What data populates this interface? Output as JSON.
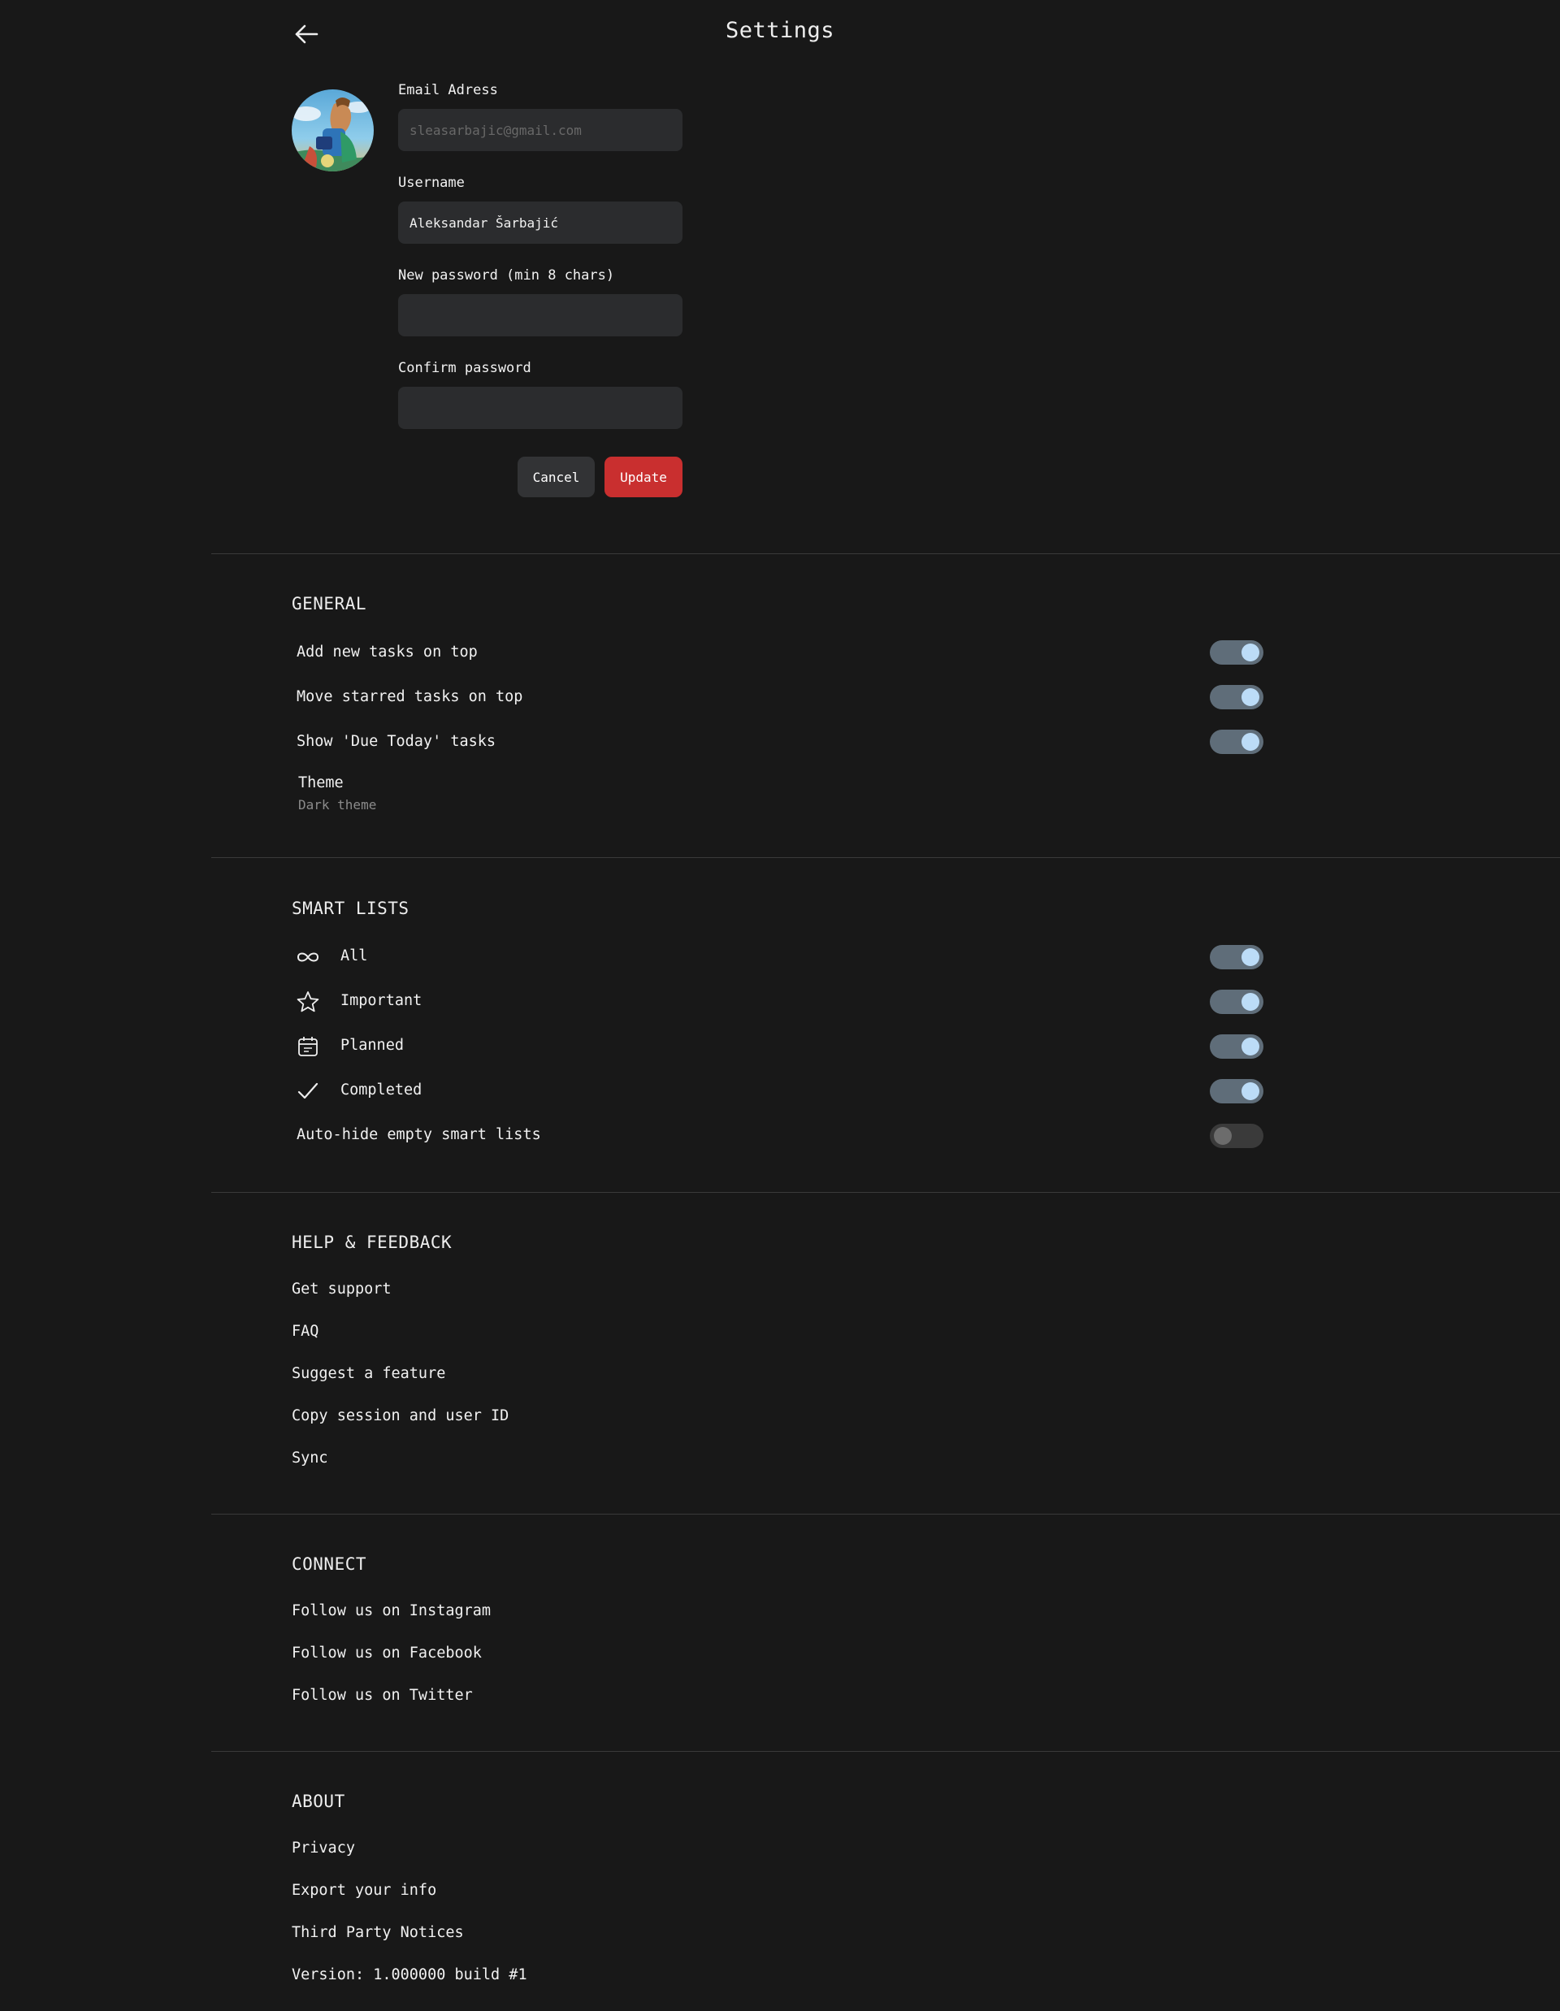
{
  "header": {
    "title": "Settings"
  },
  "profile": {
    "email": {
      "label": "Email Adress",
      "placeholder": "sleasarbajic@gmail.com",
      "value": ""
    },
    "username": {
      "label": "Username",
      "value": "Aleksandar Šarbajić"
    },
    "new_password": {
      "label": "New password (min 8 chars)",
      "value": ""
    },
    "confirm_password": {
      "label": "Confirm password",
      "value": ""
    },
    "cancel_label": "Cancel",
    "update_label": "Update"
  },
  "general": {
    "title": "GENERAL",
    "items": [
      {
        "label": "Add new tasks on top",
        "enabled": true
      },
      {
        "label": "Move starred tasks on top",
        "enabled": true
      },
      {
        "label": "Show 'Due Today' tasks",
        "enabled": true
      }
    ],
    "theme": {
      "label": "Theme",
      "value": "Dark theme"
    }
  },
  "smart_lists": {
    "title": "SMART LISTS",
    "items": [
      {
        "label": "All",
        "icon": "infinity-icon",
        "enabled": true
      },
      {
        "label": "Important",
        "icon": "star-icon",
        "enabled": true
      },
      {
        "label": "Planned",
        "icon": "calendar-icon",
        "enabled": true
      },
      {
        "label": "Completed",
        "icon": "checkmark-icon",
        "enabled": true
      }
    ],
    "auto_hide": {
      "label": "Auto-hide empty smart lists",
      "enabled": false
    }
  },
  "help": {
    "title": "HELP & FEEDBACK",
    "links": [
      "Get support",
      "FAQ",
      "Suggest a feature",
      "Copy session and user ID",
      "Sync"
    ]
  },
  "connect": {
    "title": "CONNECT",
    "links": [
      "Follow us on Instagram",
      "Follow us on Facebook",
      "Follow us on Twitter"
    ]
  },
  "about": {
    "title": "ABOUT",
    "links": [
      "Privacy",
      "Export your info",
      "Third Party Notices"
    ],
    "version": "Version: 1.000000 build #1"
  },
  "colors": {
    "background": "#181818",
    "field_bg": "#2b2c2e",
    "accent_red": "#c92f2f",
    "toggle_on_track": "#5f6d79",
    "toggle_on_knob": "#bcdcf7"
  }
}
